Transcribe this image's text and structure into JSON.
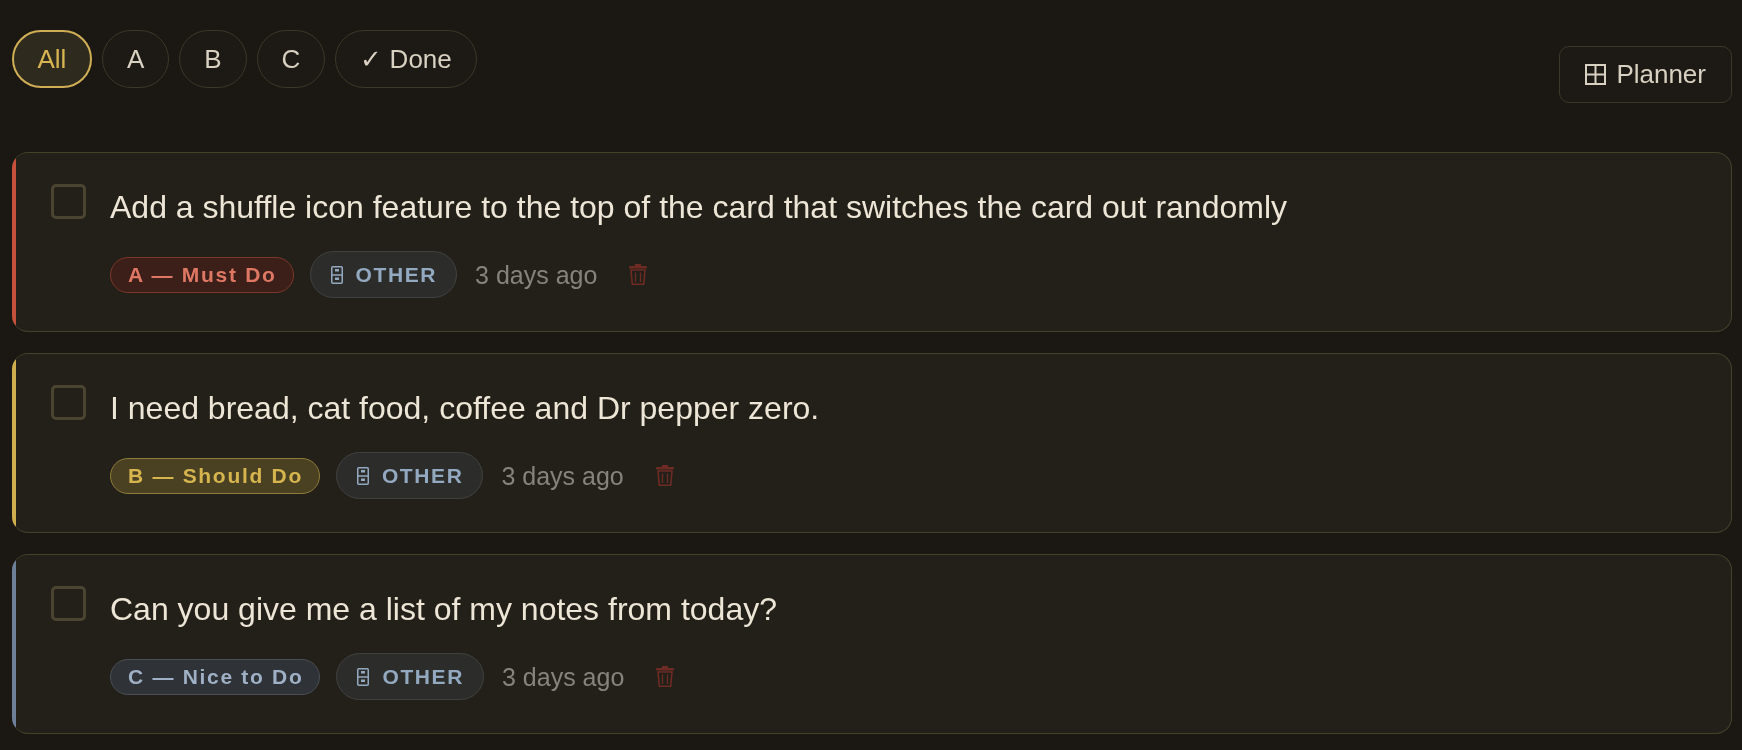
{
  "filters": [
    {
      "label": "All",
      "selected": true
    },
    {
      "label": "A",
      "selected": false
    },
    {
      "label": "B",
      "selected": false
    },
    {
      "label": "C",
      "selected": false
    },
    {
      "label": "✓ Done",
      "selected": false
    }
  ],
  "planner_button": {
    "label": "Planner"
  },
  "tasks": [
    {
      "text": "Add a shuffle icon feature to the top of the card that switches the card out randomly",
      "checked": false,
      "color": "#c4513b",
      "priority": {
        "kind": "must",
        "label": "A — Must Do"
      },
      "category": "OTHER",
      "time": "3 days ago"
    },
    {
      "text": "I need bread, cat food, coffee and Dr pepper zero.",
      "checked": false,
      "color": "#cfae4f",
      "priority": {
        "kind": "should",
        "label": "B — Should Do"
      },
      "category": "OTHER",
      "time": "3 days ago"
    },
    {
      "text": "Can you give me a list of my notes from today?",
      "checked": false,
      "color": "#6e7f9a",
      "priority": {
        "kind": "nice",
        "label": "C — Nice to Do"
      },
      "category": "OTHER",
      "time": "3 days ago"
    }
  ]
}
